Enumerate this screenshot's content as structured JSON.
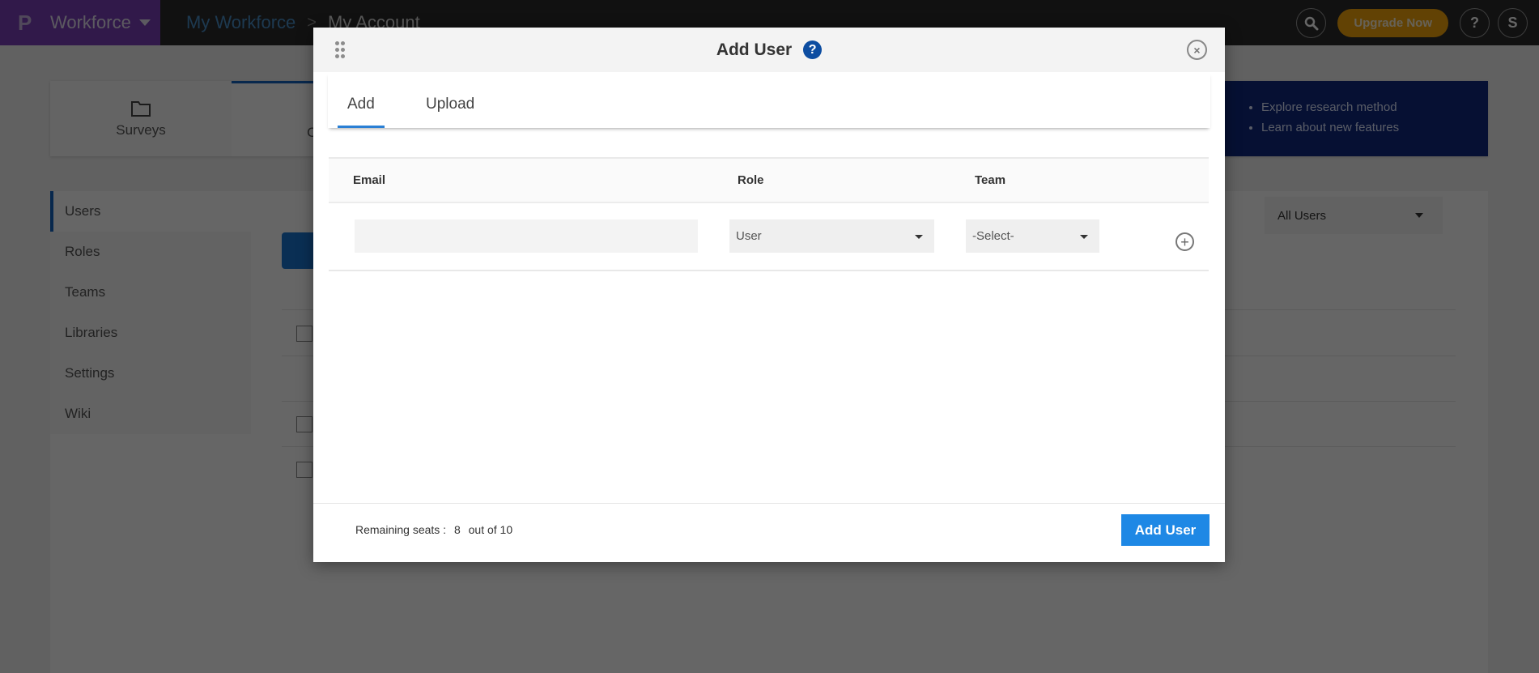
{
  "topbar": {
    "brand_logo": "P",
    "brand_name": "Workforce",
    "breadcrumb": [
      "My Workforce",
      "My Account"
    ],
    "breadcrumb_separator": ">",
    "upgrade_label": "Upgrade Now",
    "help_label": "?",
    "avatar_initial": "S",
    "brand_color": "#7a40b8",
    "upgrade_color": "#f5a60c"
  },
  "nav_cards": [
    {
      "label": "Surveys",
      "icon": "folder-icon"
    },
    {
      "label": "Orga",
      "icon": "organization-icon"
    }
  ],
  "promo": {
    "items": [
      "Explore research method",
      "Learn about new features"
    ]
  },
  "sidebar": {
    "items": [
      {
        "label": "Users",
        "active": true
      },
      {
        "label": "Roles"
      },
      {
        "label": "Teams"
      },
      {
        "label": "Libraries"
      },
      {
        "label": "Settings"
      },
      {
        "label": "Wiki"
      }
    ]
  },
  "filter": {
    "selected": "All Users"
  },
  "modal": {
    "title": "Add User",
    "help_icon": "?",
    "close_icon": "×",
    "tabs": [
      {
        "label": "Add",
        "active": true
      },
      {
        "label": "Upload",
        "active": false
      }
    ],
    "columns": [
      "Email",
      "Role",
      "Team"
    ],
    "rows": [
      {
        "email": "",
        "email_placeholder": "",
        "role": "User",
        "team": "-Select-"
      }
    ],
    "add_row_icon": "+",
    "footer": {
      "remaining_label": "Remaining seats :",
      "remaining": "8",
      "out_of_label": "out of 10"
    },
    "submit_label": "Add User",
    "accent_color": "#1e88e5"
  }
}
